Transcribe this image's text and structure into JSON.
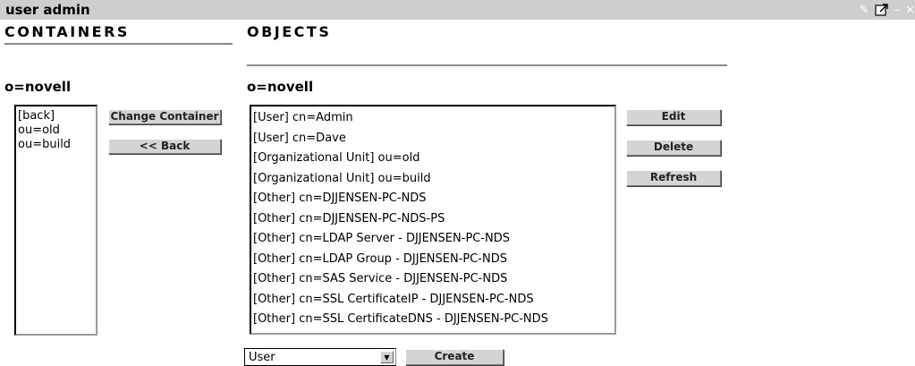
{
  "window": {
    "title": "user admin",
    "icons": [
      "edit-icon",
      "popout-icon",
      "minimize-icon",
      "close-icon"
    ]
  },
  "containers": {
    "heading": "CONTAINERS",
    "context": "o=novell",
    "items": [
      "[back]",
      "ou=old",
      "ou=build"
    ],
    "change_container_label": "Change Container",
    "back_label": "<< Back"
  },
  "objects": {
    "heading": "OBJECTS",
    "context": "o=novell",
    "items": [
      "[User] cn=Admin",
      "[User] cn=Dave",
      "[Organizational Unit] ou=old",
      "[Organizational Unit] ou=build",
      "[Other] cn=DJJENSEN-PC-NDS",
      "[Other] cn=DJJENSEN-PC-NDS-PS",
      "[Other] cn=LDAP Server - DJJENSEN-PC-NDS",
      "[Other] cn=LDAP Group - DJJENSEN-PC-NDS",
      "[Other] cn=SAS Service - DJJENSEN-PC-NDS",
      "[Other] cn=SSL CertificateIP - DJJENSEN-PC-NDS",
      "[Other] cn=SSL CertificateDNS - DJJENSEN-PC-NDS"
    ],
    "edit_label": "Edit",
    "delete_label": "Delete",
    "refresh_label": "Refresh",
    "type_select_value": "User",
    "create_label": "Create"
  }
}
